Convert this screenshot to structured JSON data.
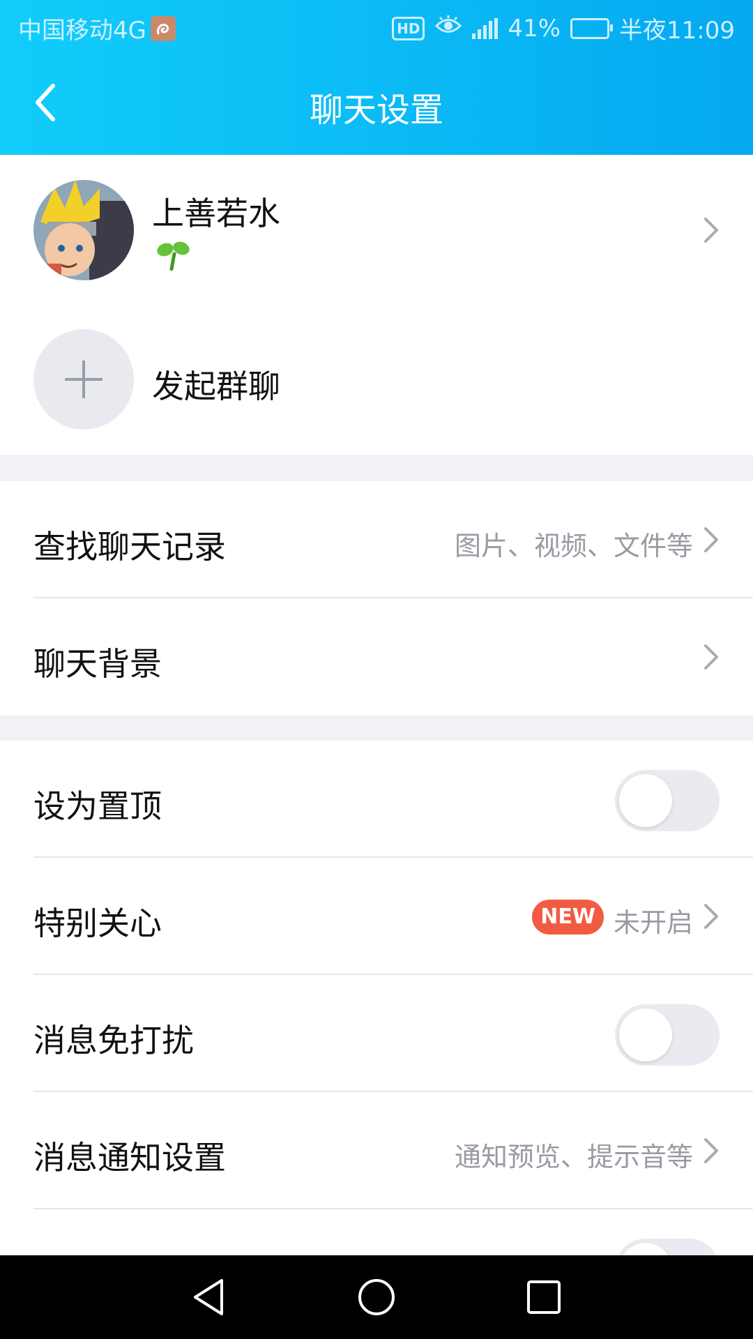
{
  "status_bar": {
    "carrier": "中国移动4G",
    "hd": "HD",
    "network": "4G",
    "battery_percent": "41%",
    "time": "半夜11:09",
    "colors": {
      "text": "#cfefff"
    }
  },
  "header": {
    "title": "聊天设置",
    "back_icon": "chevron-left-icon",
    "gradient": [
      "#11cdfa",
      "#05a9f0"
    ]
  },
  "profile": {
    "name": "上善若水",
    "level_icon": "sprout-icon"
  },
  "group": {
    "label": "发起群聊",
    "icon": "plus-icon"
  },
  "settings": [
    {
      "label": "查找聊天记录",
      "desc": "图片、视频、文件等"
    },
    {
      "label": "聊天背景"
    },
    {
      "label": "设为置顶",
      "toggle_on": false
    },
    {
      "label": "特别关心",
      "badge": "NEW",
      "desc": "未开启"
    },
    {
      "label": "消息免打扰",
      "toggle_on": false
    },
    {
      "label": "消息通知设置",
      "desc": "通知预览、提示音等"
    }
  ],
  "nav": {
    "back": "triangle-back-icon",
    "home": "circle-home-icon",
    "recents": "square-recents-icon"
  }
}
